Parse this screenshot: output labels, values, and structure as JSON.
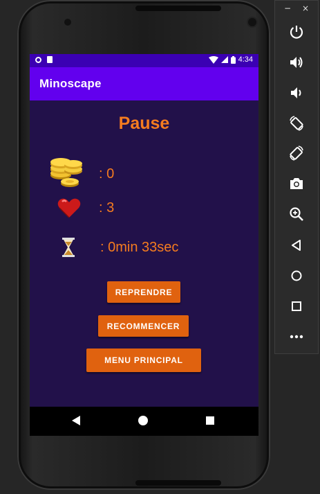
{
  "status_bar": {
    "time": "4:34"
  },
  "app_bar": {
    "title": "Minoscape"
  },
  "pause": {
    "title": "Pause",
    "coins_text": ": 0",
    "lives_text": ": 3",
    "time_text": ": 0min  33sec"
  },
  "buttons": {
    "resume": "REPRENDRE",
    "restart": "RECOMMENCER",
    "main_menu": "MENU PRINCIPAL"
  },
  "colors": {
    "accent": "#f57c1f",
    "button": "#e0620f",
    "app_bar": "#6200ee",
    "status_bar": "#3b00b3",
    "background": "#22114a"
  },
  "emulator_toolbar": {
    "minimize": "−",
    "close": "×",
    "tools": [
      "power-icon",
      "volume-up-icon",
      "volume-down-icon",
      "rotate-left-icon",
      "rotate-right-icon",
      "camera-icon",
      "zoom-icon",
      "back-icon",
      "home-icon",
      "overview-icon",
      "more-icon"
    ]
  }
}
